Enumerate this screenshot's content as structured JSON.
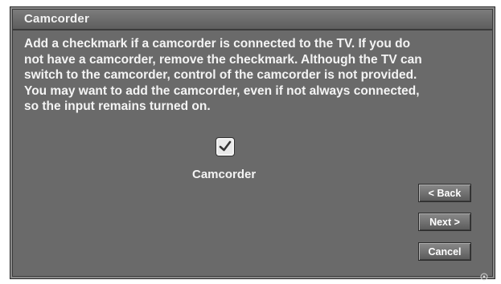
{
  "dialog": {
    "title": "Camcorder",
    "message": "Add a checkmark if a camcorder is connected to the TV.   If you do\nnot have a camcorder, remove the checkmark. Although the TV can\nswitch to the camcorder, control of the camcorder is not provided.\nYou may want to add the camcorder, even if not always connected,\nso the input remains turned on.",
    "checkbox": {
      "label": "Camcorder",
      "checked": true,
      "icon": "checkmark-icon"
    },
    "buttons": {
      "back": "< Back",
      "next": "Next >",
      "cancel": "Cancel"
    }
  },
  "corner_icon": "registered-icon",
  "colors": {
    "dialog_bg": "#6a6a6a",
    "text": "#f4f4f4"
  }
}
